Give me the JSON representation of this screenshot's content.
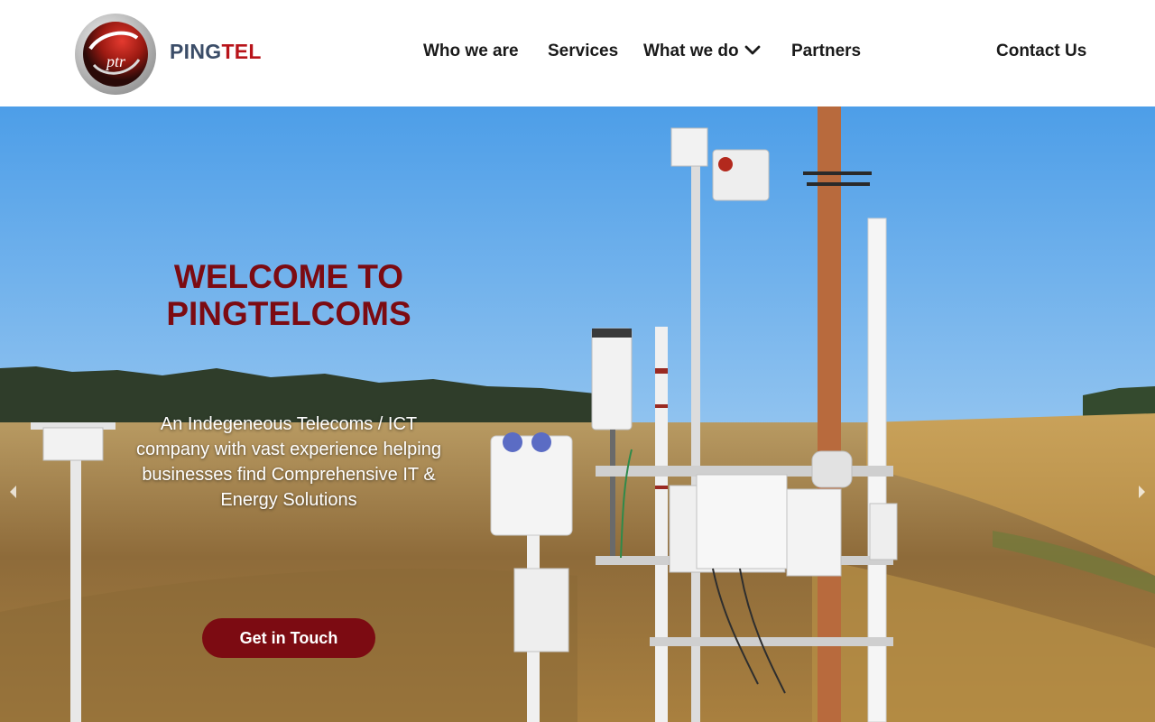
{
  "header": {
    "brand_part1": "PING",
    "brand_part2": "TEL",
    "logo_text": "ptr",
    "nav": [
      {
        "label": "Who we are"
      },
      {
        "label": "Services"
      },
      {
        "label": "What we do"
      },
      {
        "label": "Partners"
      }
    ],
    "contact_label": "Contact Us"
  },
  "hero": {
    "title_line1": "WELCOME TO",
    "title_line2": "PINGTELCOMS",
    "subtitle": "An Indegeneous Telecoms / ICT company with vast experience helping businesses find Comprehensive IT & Energy Solutions",
    "cta_label": "Get in Touch"
  },
  "colors": {
    "brand_dark": "#3b4d68",
    "brand_red": "#b8141a",
    "accent_maroon": "#7c0b12"
  },
  "icons": {
    "dropdown": "chevron-down-icon",
    "slider_prev": "chevron-left-icon",
    "slider_next": "chevron-right-icon"
  }
}
